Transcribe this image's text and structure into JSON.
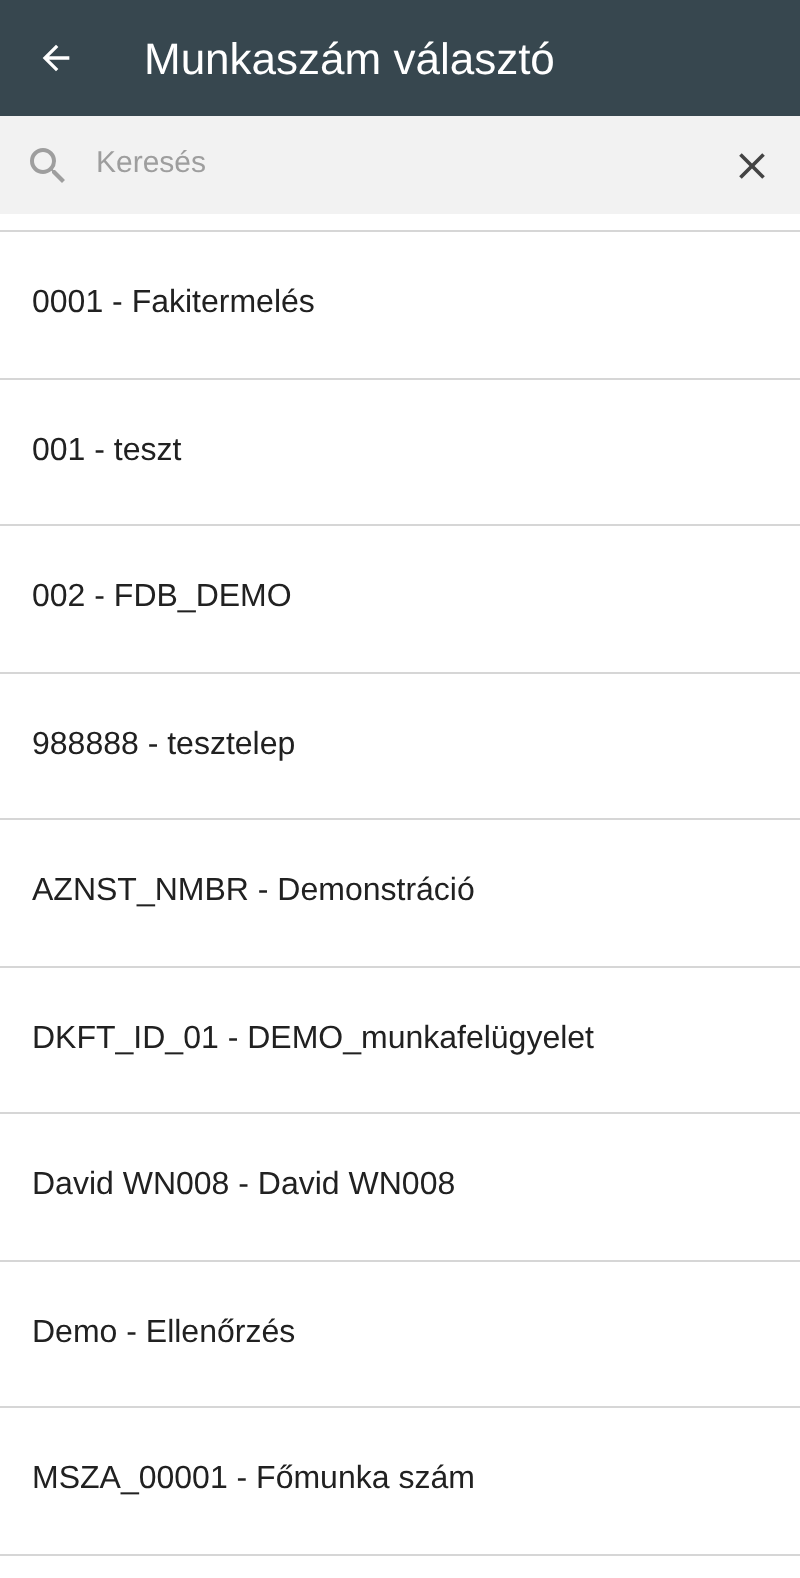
{
  "header": {
    "title": "Munkaszám választó"
  },
  "search": {
    "placeholder": "Keresés"
  },
  "items": [
    {
      "label": "0001 - Fakitermelés"
    },
    {
      "label": "001 - teszt"
    },
    {
      "label": "002 - FDB_DEMO"
    },
    {
      "label": "988888 - tesztelep"
    },
    {
      "label": "AZNST_NMBR - Demonstráció"
    },
    {
      "label": "DKFT_ID_01 - DEMO_munkafelügyelet"
    },
    {
      "label": "David WN008 - David WN008"
    },
    {
      "label": "Demo - Ellenőrzés"
    },
    {
      "label": "MSZA_00001 - Főmunka szám"
    }
  ]
}
